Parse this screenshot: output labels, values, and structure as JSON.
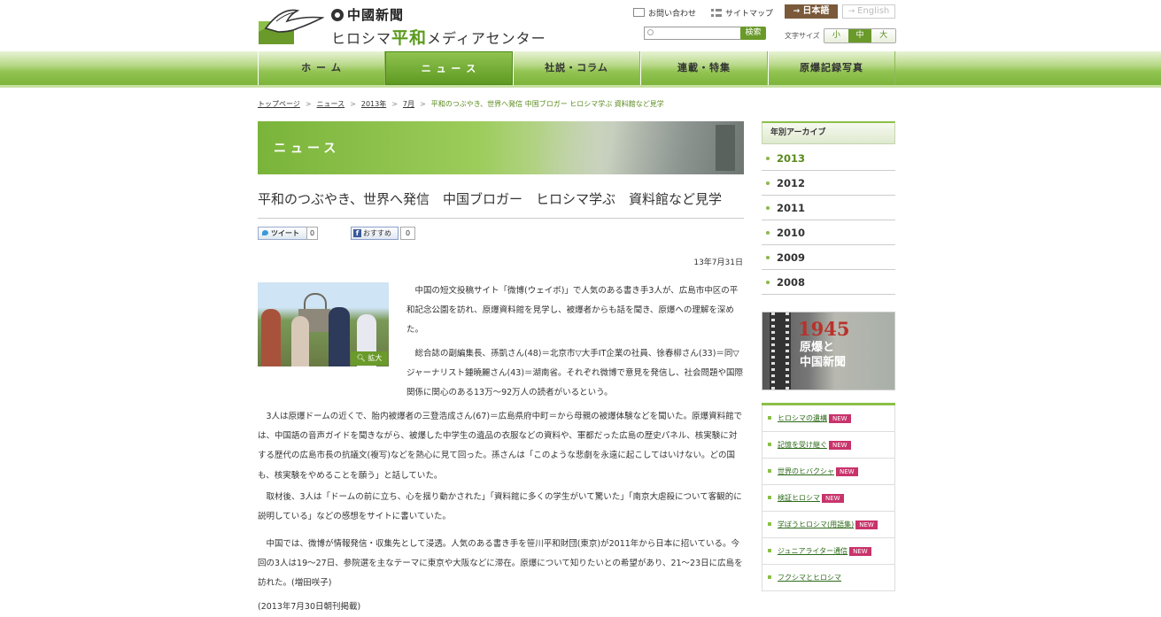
{
  "header": {
    "paper_name": "中國新聞",
    "center_prefix": "ヒロシマ",
    "center_highlight": "平和",
    "center_suffix": "メディアセンター",
    "contact": "お問い合わせ",
    "sitemap": "サイトマップ",
    "lang_ja": "日本語",
    "lang_en": "English",
    "search_placeholder": "",
    "search_button": "検索",
    "fontsize_label": "文字サイズ",
    "fontsize_options": [
      "小",
      "中",
      "大"
    ]
  },
  "nav": [
    "ホ ー ム",
    "ニ ュ ー ス",
    "社説・コラム",
    "連載・特集",
    "原爆記録写真"
  ],
  "breadcrumb": {
    "items": [
      "トップページ",
      "ニュース",
      "2013年",
      "7月"
    ],
    "current": "平和のつぶやき、世界へ発信 中国ブロガー ヒロシマ学ぶ 資料館など見学"
  },
  "main": {
    "banner_title": "ニュース",
    "title": "平和のつぶやき、世界へ発信　中国ブロガー　ヒロシマ学ぶ　資料館など見学",
    "tweet_label": "ツイート",
    "tweet_count": "0",
    "fb_label": "おすすめ",
    "fb_count": "0",
    "date": "13年7月31日",
    "enlarge": "拡大",
    "paragraphs": [
      "　中国の短文投稿サイト「微博(ウェイボ)」で人気のある書き手3人が、広島市中区の平和記念公園を訪れ、原爆資料館を見学し、被爆者からも話を聞き、原爆への理解を深めた。",
      "　総合誌の副編集長、孫凱さん(48)＝北京市▽大手IT企業の社員、徐春柳さん(33)＝同▽ジャーナリスト鍾曉麗さん(43)＝湖南省。それぞれ微博で意見を発信し、社会問題や国際関係に関心のある13万～92万人の読者がいるという。",
      "　3人は原爆ドームの近くで、胎内被爆者の三登浩成さん(67)＝広島県府中町＝から母親の被爆体験などを聞いた。原爆資料館では、中国語の音声ガイドを聞きながら、被爆した中学生の遺品の衣服などの資料や、軍都だった広島の歴史パネル、核実験に対する歴代の広島市長の抗議文(複写)などを熱心に見て回った。孫さんは「このような悲劇を永遠に起こしてはいけない。どの国も、核実験をやめることを願う」と話していた。",
      "　取材後、3人は「ドームの前に立ち、心を揺り動かされた」「資料館に多くの学生がいて驚いた」「南京大虐殺について客観的に説明している」などの感想をサイトに書いていた。",
      "　中国では、微博が情報発信・収集先として浸透。人気のある書き手を笹川平和財団(東京)が2011年から日本に招いている。今回の3人は19～27日、参院選を主なテーマに東京や大阪などに滞在。原爆について知りたいとの希望があり、21～23日に広島を訪れた。(増田咲子)",
      "(2013年7月30日朝刊掲載)"
    ]
  },
  "sidebar": {
    "archive_title": "年別アーカイブ",
    "years": [
      "2013",
      "2012",
      "2011",
      "2010",
      "2009",
      "2008"
    ],
    "promo_year": "1945",
    "promo_line1": "原爆と",
    "promo_line2": "中国新聞",
    "new_badge": "NEW",
    "links": [
      {
        "label": "ヒロシマの遺構",
        "new": true
      },
      {
        "label": "記憶を受け継ぐ",
        "new": true
      },
      {
        "label": "世界のヒバクシャ",
        "new": true
      },
      {
        "label": "検証ヒロシマ",
        "new": true
      },
      {
        "label": "学ぼうヒロシマ(用語集)",
        "new": true
      },
      {
        "label": "ジュニアライター通信",
        "new": true
      },
      {
        "label": "フクシマとヒロシマ",
        "new": false
      }
    ]
  },
  "colors": {
    "brand_green": "#6a9a2a",
    "new_badge": "#c8336a",
    "lang_active": "#7a5a3a"
  }
}
